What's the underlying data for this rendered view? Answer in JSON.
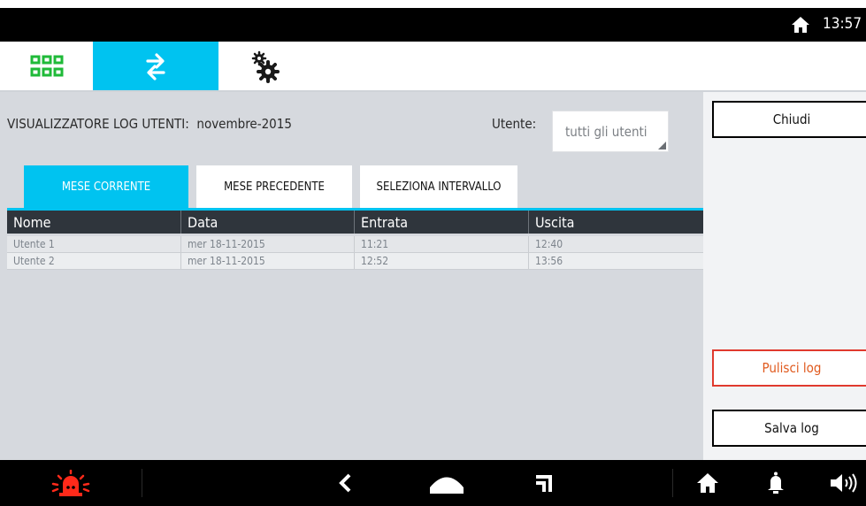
{
  "status": {
    "time": "13:57",
    "home_icon": "home-icon"
  },
  "toolbar": {
    "items": [
      {
        "name": "apps-grid-icon"
      },
      {
        "name": "transfer-arrows-icon",
        "active": true
      },
      {
        "name": "settings-gears-icon"
      }
    ],
    "accent": "#00c3f0"
  },
  "log": {
    "title": "VISUALIZZATORE LOG UTENTI:  novembre-2015",
    "user_label": "Utente:",
    "user_value": "tutti gli utenti"
  },
  "tabs": [
    {
      "label": "MESE CORRENTE",
      "active": true
    },
    {
      "label": "MESE PRECEDENTE"
    },
    {
      "label": "SELEZIONA INTERVALLO"
    }
  ],
  "table": {
    "headers": [
      "Nome",
      "Data",
      "Entrata",
      "Uscita"
    ],
    "rows": [
      [
        "Utente 1",
        "mer 18-11-2015",
        "11:21",
        "12:40"
      ],
      [
        "Utente 2",
        "mer 18-11-2015",
        "12:52",
        "13:56"
      ]
    ]
  },
  "side": {
    "close_label": "Chiudi",
    "clear_label": "Pulisci log",
    "save_label": "Salva log",
    "clear_color": "#e03a2e"
  }
}
